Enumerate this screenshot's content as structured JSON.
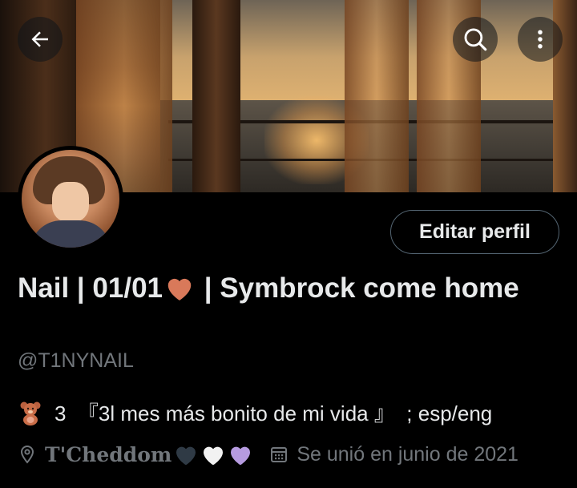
{
  "header": {
    "back_icon": "arrow-left-icon",
    "search_icon": "search-icon",
    "more_icon": "more-vertical-icon"
  },
  "profile": {
    "display_name_part1": "Nail | 01/01",
    "display_name_part2": " | Symbrock come home",
    "handle": "@T1NYNAIL",
    "edit_button": "Editar perfil",
    "bio_text": "3  『3l mes más bonito de mi vida 』  ; esp/eng",
    "location": "T'Cheddom",
    "joined": "Se unió en junio de 2021"
  },
  "colors": {
    "background": "#000000",
    "text_primary": "#e7e9ea",
    "text_secondary": "#71767b",
    "name_heart": "#d9795a",
    "heart_dark": "#2f3a45",
    "heart_white": "#f2f2f2",
    "heart_purple": "#b69be0",
    "button_border": "#536471"
  }
}
